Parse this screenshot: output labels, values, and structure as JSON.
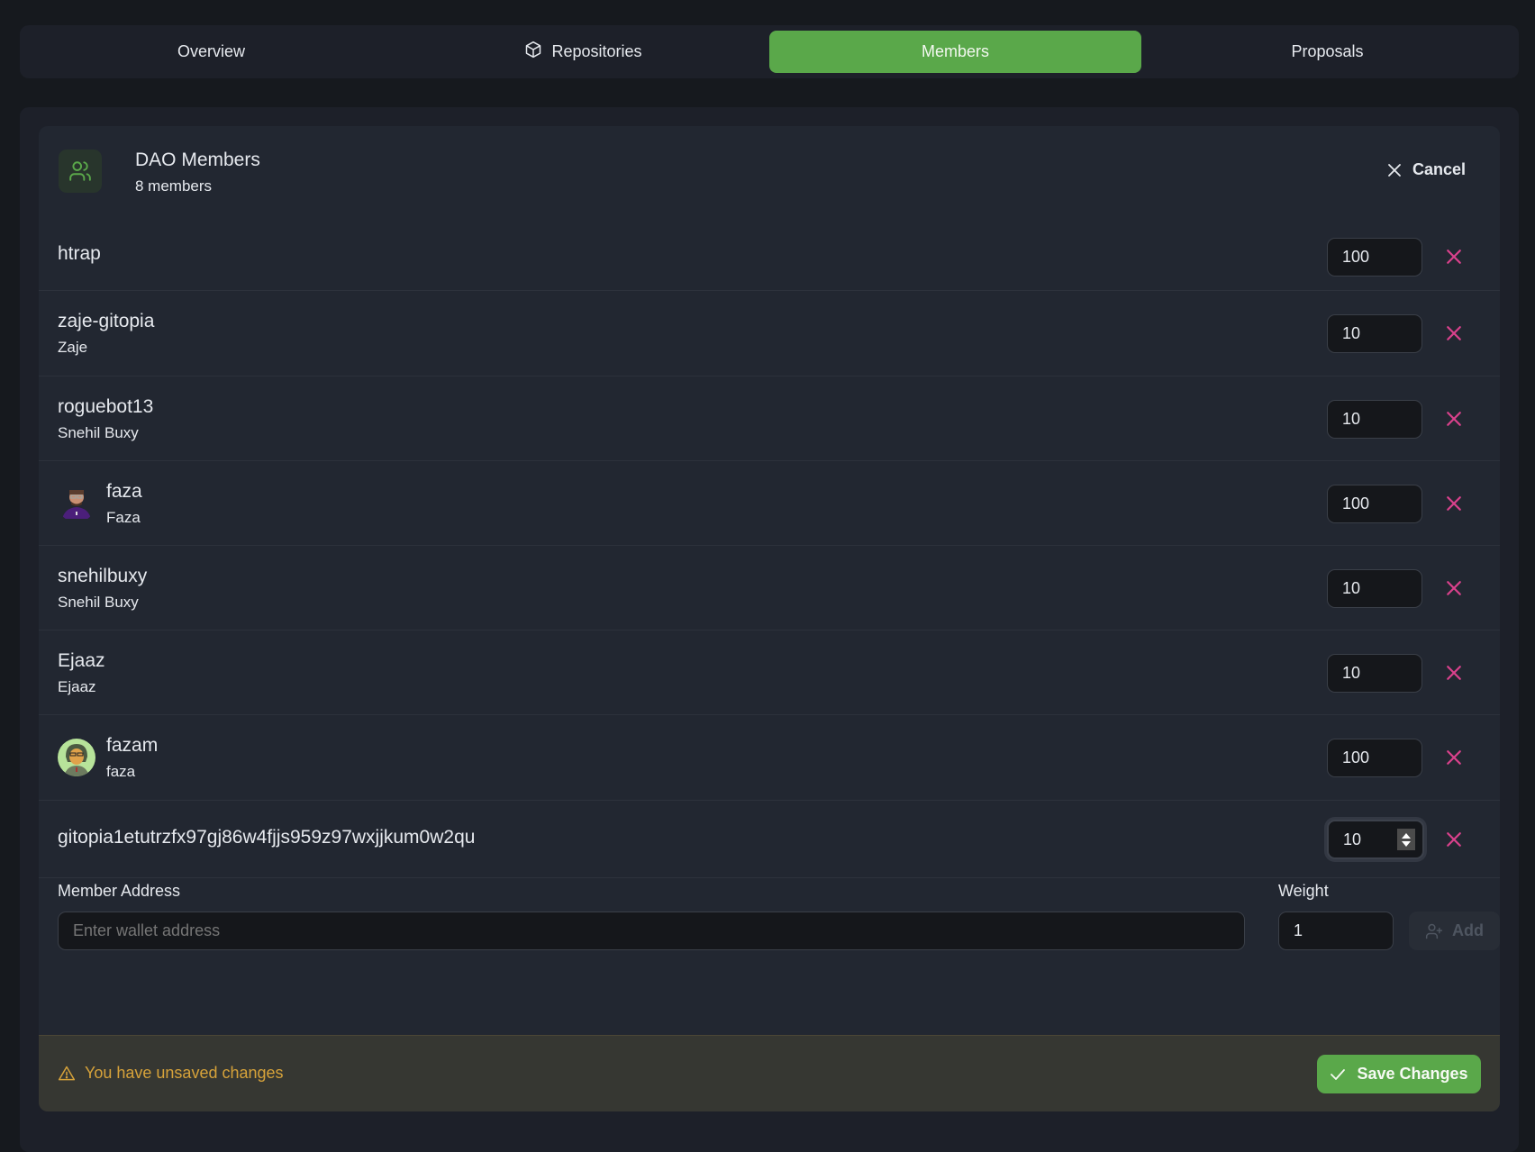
{
  "tabs": [
    {
      "label": "Overview",
      "icon": null,
      "active": false
    },
    {
      "label": "Repositories",
      "icon": "box-icon",
      "active": false
    },
    {
      "label": "Members",
      "icon": null,
      "active": true
    },
    {
      "label": "Proposals",
      "icon": null,
      "active": false
    }
  ],
  "header": {
    "icon": "users-icon",
    "title": "DAO Members",
    "subtitle": "8 members",
    "cancel_label": "Cancel"
  },
  "members": [
    {
      "username": "htrap",
      "display_name": null,
      "avatar": null,
      "weight": "100"
    },
    {
      "username": "zaje-gitopia",
      "display_name": "Zaje",
      "avatar": null,
      "weight": "10"
    },
    {
      "username": "roguebot13",
      "display_name": "Snehil Buxy",
      "avatar": null,
      "weight": "10"
    },
    {
      "username": "faza",
      "display_name": "Faza",
      "avatar": "pixel-avatar-icon",
      "weight": "100"
    },
    {
      "username": "snehilbuxy",
      "display_name": "Snehil Buxy",
      "avatar": null,
      "weight": "10"
    },
    {
      "username": "Ejaaz",
      "display_name": "Ejaaz",
      "avatar": null,
      "weight": "10"
    },
    {
      "username": "fazam",
      "display_name": "faza",
      "avatar": "cartoon-avatar-icon",
      "weight": "100"
    },
    {
      "username": "gitopia1etutrzfx97gj86w4fjjs959z97wxjjkum0w2qu",
      "display_name": null,
      "avatar": null,
      "weight": "10",
      "focused": true
    }
  ],
  "add_member": {
    "address_label": "Member Address",
    "address_placeholder": "Enter wallet address",
    "address_value": "",
    "weight_label": "Weight",
    "weight_value": "1",
    "add_label": "Add"
  },
  "footer": {
    "warning": "You have unsaved changes",
    "save_label": "Save Changes"
  },
  "colors": {
    "accent": "#5aa84a",
    "danger": "#d9418c",
    "warning": "#d6a23a"
  }
}
